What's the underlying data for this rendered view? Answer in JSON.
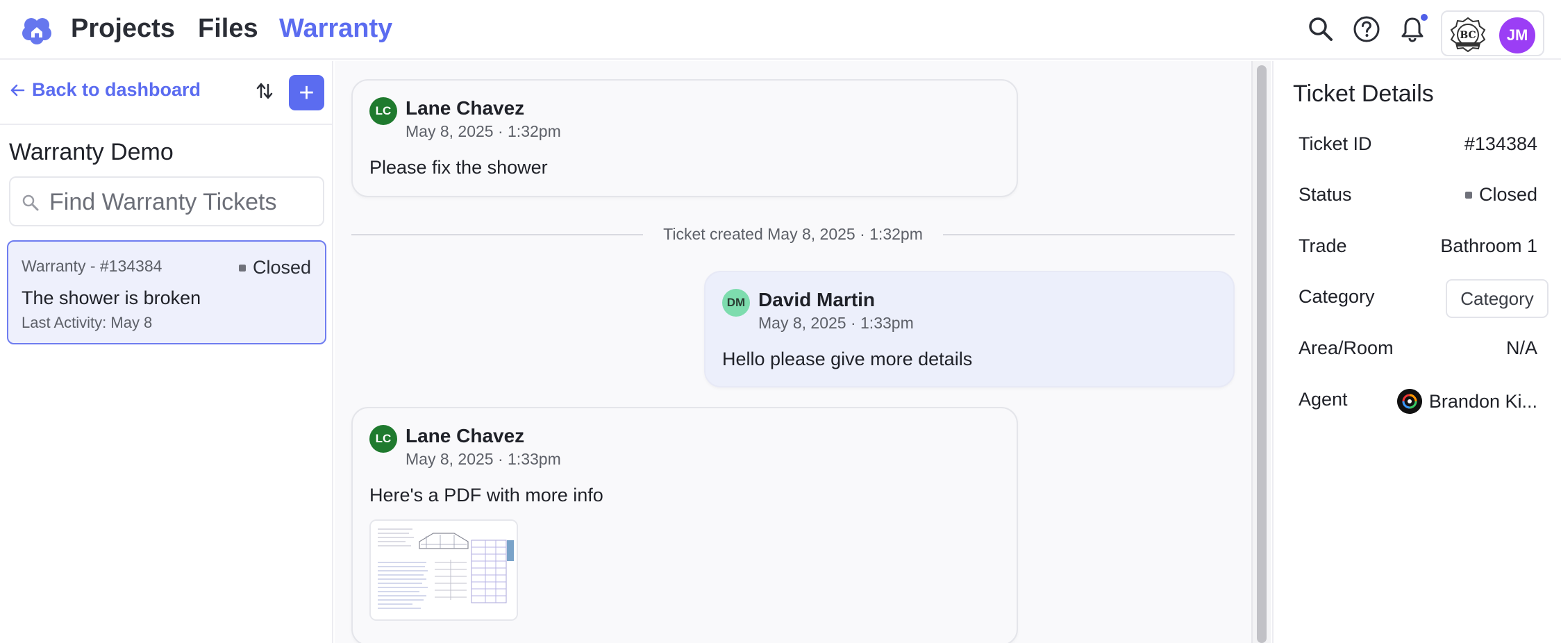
{
  "nav": {
    "items": [
      {
        "label": "Projects",
        "active": false
      },
      {
        "label": "Files",
        "active": false
      },
      {
        "label": "Warranty",
        "active": true
      }
    ],
    "accent_color": "#5b6cf0",
    "user_initials": "JM",
    "company_logo_text": "BC",
    "icons": [
      "search-icon",
      "help-icon",
      "bell-icon"
    ]
  },
  "sidebar": {
    "back_label": "Back to dashboard",
    "add_label": "+",
    "project_title": "Warranty Demo",
    "search_placeholder": "Find Warranty Tickets",
    "tickets": [
      {
        "ref": "Warranty - #134384",
        "status": "Closed",
        "title": "The shower is broken",
        "activity": "Last Activity: May 8"
      }
    ]
  },
  "feed": {
    "messages": [
      {
        "initials": "LC",
        "author": "Lane Chavez",
        "time": "May 8, 2025 · 1:32pm",
        "text": "Please fix the shower"
      },
      {
        "initials": "DM",
        "author": "David Martin",
        "time": "May 8, 2025 · 1:33pm",
        "text": "Hello please give more details"
      },
      {
        "initials": "LC",
        "author": "Lane Chavez",
        "time": "May 8, 2025 · 1:33pm",
        "text": "Here's a PDF with more info"
      }
    ],
    "event": "Ticket created May 8, 2025 · 1:32pm"
  },
  "details": {
    "title": "Ticket Details",
    "rows": [
      {
        "label": "Ticket ID",
        "value": "#134384"
      },
      {
        "label": "Status",
        "value": "Closed"
      },
      {
        "label": "Trade",
        "value": "Bathroom 1"
      },
      {
        "label": "Category",
        "value": "Category"
      },
      {
        "label": "Area/Room",
        "value": "N/A"
      },
      {
        "label": "Agent",
        "value": "Brandon Ki..."
      }
    ]
  }
}
